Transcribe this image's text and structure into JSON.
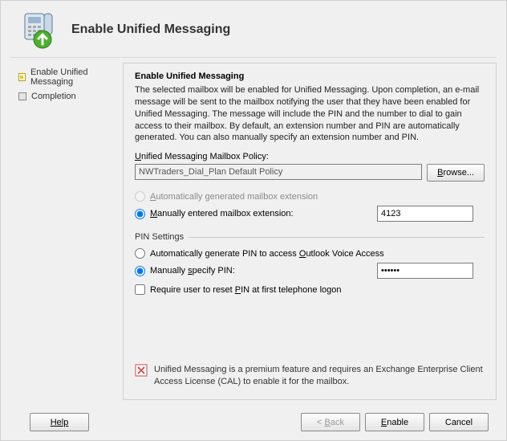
{
  "header": {
    "title": "Enable Unified Messaging"
  },
  "sidebar": {
    "steps": [
      {
        "label": "Enable Unified Messaging",
        "active": true
      },
      {
        "label": "Completion",
        "active": false
      }
    ]
  },
  "content": {
    "title": "Enable Unified Messaging",
    "description": "The selected mailbox will be enabled for Unified Messaging. Upon completion, an e-mail message will be sent to the mailbox notifying the user that they have been enabled for Unified Messaging. The message will include the PIN and the number to dial to gain access to their mailbox. By default, an extension number and PIN are automatically generated. You can also manually specify an extension number and PIN.",
    "policy_label_pre": "U",
    "policy_label_post": "nified Messaging Mailbox Policy:",
    "policy_value": "NWTraders_Dial_Plan Default Policy",
    "browse_pre": "B",
    "browse_post": "rowse...",
    "ext_auto_pre": "A",
    "ext_auto_post": "utomatically generated mailbox extension",
    "ext_manual_pre": "M",
    "ext_manual_post": "anually entered mailbox extension:",
    "ext_value": "4123",
    "pin_section": "PIN Settings",
    "pin_auto_pre": "Automatically generate PIN to access ",
    "pin_auto_u": "O",
    "pin_auto_post": "utlook Voice Access",
    "pin_manual_pre": "Manually ",
    "pin_manual_u": "s",
    "pin_manual_post": "pecify PIN:",
    "pin_value": "••••••",
    "require_pre": "Require user to reset ",
    "require_u": "P",
    "require_post": "IN at first telephone logon",
    "info_text": "Unified Messaging is a premium feature and requires an Exchange Enterprise Client Access License (CAL) to enable it for the mailbox."
  },
  "footer": {
    "help": "Help",
    "back_pre": "< ",
    "back_u": "B",
    "back_post": "ack",
    "enable_u": "E",
    "enable_post": "nable",
    "cancel": "Cancel"
  }
}
